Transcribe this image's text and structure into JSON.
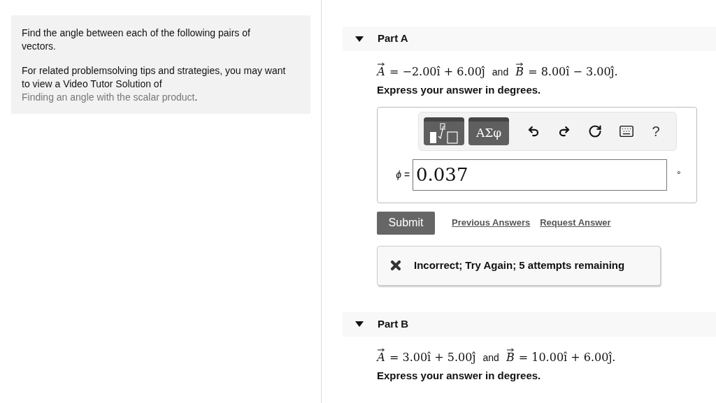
{
  "intro": {
    "question": "Find the angle between each of the following pairs of vectors.",
    "tip_text": "For related problemsolving tips and strategies, you may want to view a Video Tutor Solution of ",
    "tip_link": "Finding an angle with the scalar product",
    "tip_end": "."
  },
  "parts": [
    {
      "title": "Part A",
      "expanded": true,
      "vector_a": {
        "symbol": "A",
        "rhs": "= −2.00î + 6.00ĵ"
      },
      "joiner": "and",
      "vector_b": {
        "symbol": "B",
        "rhs": "= 8.00î − 3.00ĵ."
      },
      "instruction": "Express your answer in degrees.",
      "answer": {
        "symbols_button": "ΑΣφ",
        "help": "?",
        "label": "ϕ =",
        "value": "0.037",
        "unit": "°"
      },
      "submit": "Submit",
      "links": [
        "Previous Answers",
        "Request Answer"
      ],
      "feedback": {
        "correct": false,
        "message": "Incorrect; Try Again; 5 attempts remaining"
      }
    },
    {
      "title": "Part B",
      "expanded": true,
      "vector_a": {
        "symbol": "A",
        "rhs": "= 3.00î + 5.00ĵ"
      },
      "joiner": "and",
      "vector_b": {
        "symbol": "B",
        "rhs": "= 10.00î + 6.00ĵ."
      },
      "instruction": "Express your answer in degrees."
    }
  ]
}
